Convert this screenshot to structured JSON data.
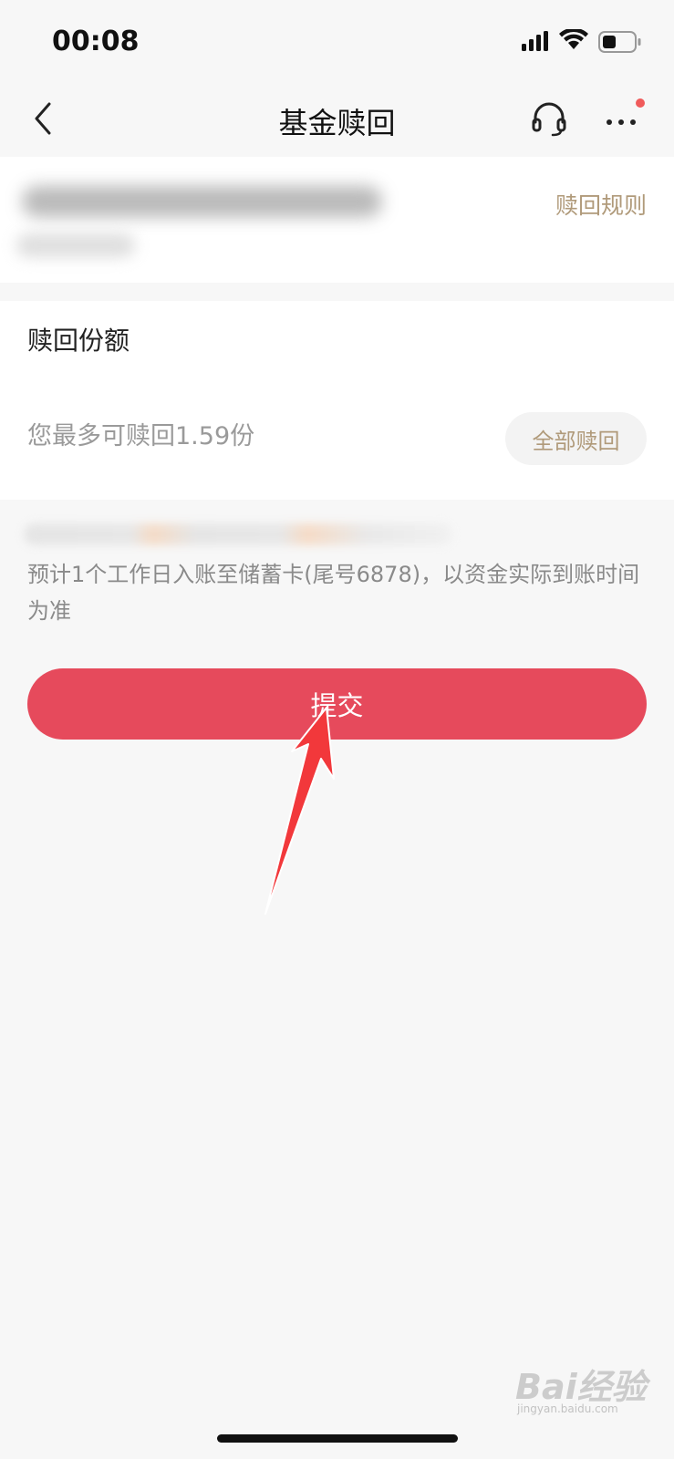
{
  "status_bar": {
    "time": "00:08",
    "icons": [
      "signal-icon",
      "wifi-icon",
      "battery-icon"
    ]
  },
  "nav": {
    "title": "基金赎回",
    "icons": [
      "chevron-left-icon",
      "headset-icon",
      "more-icon"
    ],
    "notification_dot_color": "#f05b5b"
  },
  "fund": {
    "rules_link": "赎回规则"
  },
  "redeem": {
    "label": "赎回份额",
    "placeholder": "您最多可赎回1.59份",
    "redeem_all_label": "全部赎回"
  },
  "notice": {
    "text": "预计1个工作日入账至储蓄卡(尾号6878)，以资金实际到账时间为准"
  },
  "submit": {
    "label": "提交",
    "color": "#e64a5c"
  },
  "watermark": {
    "logo": "Bai经验",
    "sub": "jingyan.baidu.com"
  },
  "colors": {
    "accent_gold": "#b09a7a",
    "background": "#f7f7f7",
    "annotation_arrow": "#f2383b"
  }
}
